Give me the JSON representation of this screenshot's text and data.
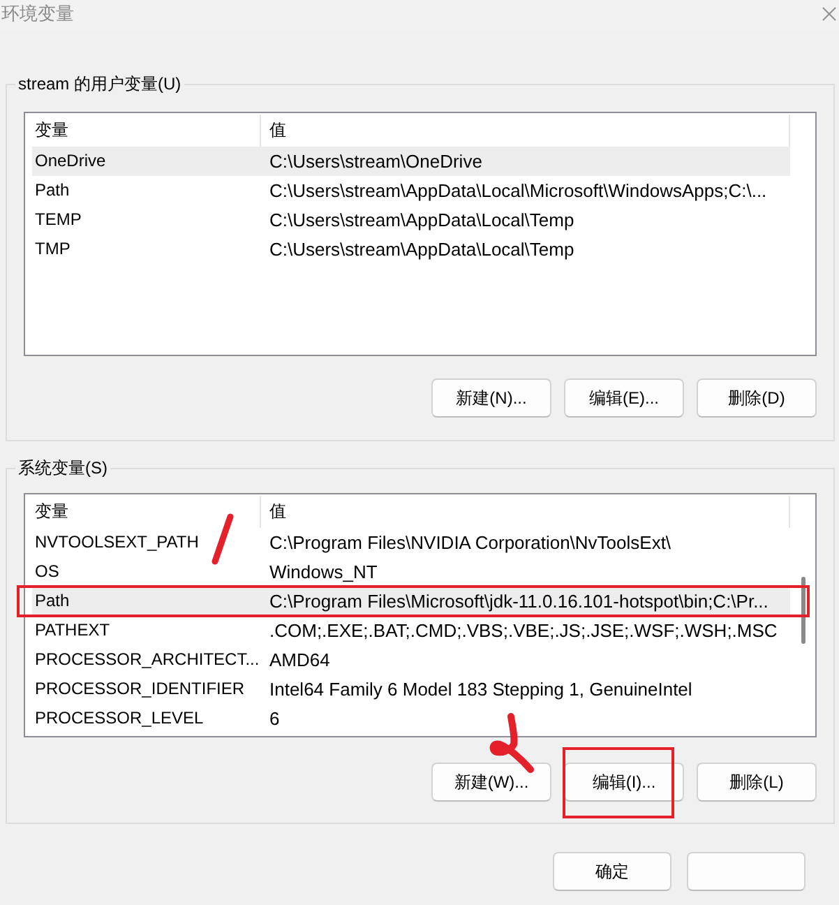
{
  "window": {
    "title": "环境变量"
  },
  "user_variables": {
    "label": "stream 的用户变量(U)",
    "columns": [
      "变量",
      "值"
    ],
    "rows": [
      {
        "name": "OneDrive",
        "value": "C:\\Users\\stream\\OneDrive",
        "selected": true
      },
      {
        "name": "Path",
        "value": "C:\\Users\\stream\\AppData\\Local\\Microsoft\\WindowsApps;C:\\...",
        "selected": false
      },
      {
        "name": "TEMP",
        "value": "C:\\Users\\stream\\AppData\\Local\\Temp",
        "selected": false
      },
      {
        "name": "TMP",
        "value": "C:\\Users\\stream\\AppData\\Local\\Temp",
        "selected": false
      }
    ],
    "buttons": [
      {
        "label": "新建(N)..."
      },
      {
        "label": "编辑(E)..."
      },
      {
        "label": "删除(D)"
      }
    ]
  },
  "system_variables": {
    "label": "系统变量(S)",
    "columns": [
      "变量",
      "值"
    ],
    "scrollable": true,
    "rows": [
      {
        "name": "NVTOOLSEXT_PATH",
        "value": "C:\\Program Files\\NVIDIA Corporation\\NvToolsExt\\",
        "selected": false,
        "annotated": false
      },
      {
        "name": "OS",
        "value": "Windows_NT",
        "selected": false,
        "annotated": false
      },
      {
        "name": "Path",
        "value": "C:\\Program Files\\Microsoft\\jdk-11.0.16.101-hotspot\\bin;C:\\Pr...",
        "selected": true,
        "annotated": true
      },
      {
        "name": "PATHEXT",
        "value": ".COM;.EXE;.BAT;.CMD;.VBS;.VBE;.JS;.JSE;.WSF;.WSH;.MSC",
        "selected": false,
        "annotated": false
      },
      {
        "name": "PROCESSOR_ARCHITECT...",
        "value": "AMD64",
        "selected": false,
        "annotated": false
      },
      {
        "name": "PROCESSOR_IDENTIFIER",
        "value": "Intel64 Family 6 Model 183 Stepping 1, GenuineIntel",
        "selected": false,
        "annotated": false
      },
      {
        "name": "PROCESSOR_LEVEL",
        "value": "6",
        "selected": false,
        "annotated": false
      }
    ],
    "buttons": [
      {
        "label": "新建(W)...",
        "annotated": false
      },
      {
        "label": "编辑(I)...",
        "annotated": true
      },
      {
        "label": "删除(L)",
        "annotated": false
      }
    ]
  },
  "dialog_buttons": [
    {
      "kind": "labeled",
      "label": "确定"
    },
    {
      "kind": "blank"
    }
  ]
}
